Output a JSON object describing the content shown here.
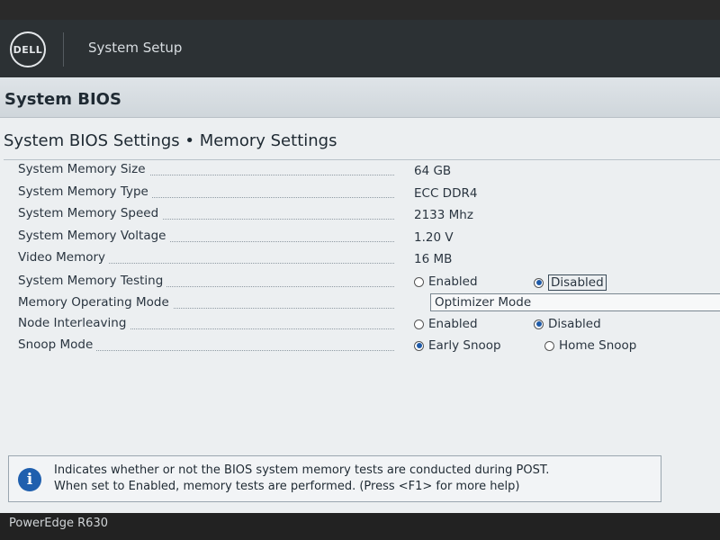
{
  "header": {
    "logo_text": "DELL",
    "app_title": "System Setup"
  },
  "section": {
    "title": "System BIOS"
  },
  "page": {
    "title": "System BIOS Settings • Memory Settings"
  },
  "settings": {
    "memory_size": {
      "label": "System Memory Size",
      "value": "64 GB"
    },
    "memory_type": {
      "label": "System Memory Type",
      "value": "ECC DDR4"
    },
    "memory_speed": {
      "label": "System Memory Speed",
      "value": "2133 Mhz"
    },
    "memory_voltage": {
      "label": "System Memory Voltage",
      "value": "1.20 V"
    },
    "video_memory": {
      "label": "Video Memory",
      "value": "16 MB"
    },
    "memory_testing": {
      "label": "System Memory Testing",
      "options": [
        "Enabled",
        "Disabled"
      ],
      "selected": "Disabled"
    },
    "operating_mode": {
      "label": "Memory Operating Mode",
      "value": "Optimizer Mode"
    },
    "node_interleaving": {
      "label": "Node Interleaving",
      "options": [
        "Enabled",
        "Disabled"
      ],
      "selected": "Disabled"
    },
    "snoop_mode": {
      "label": "Snoop Mode",
      "options": [
        "Early Snoop",
        "Home Snoop"
      ],
      "selected": "Early Snoop"
    }
  },
  "help": {
    "icon": "info-icon",
    "line1": "Indicates whether or not the BIOS system memory tests are conducted during POST.",
    "line2": "When set to Enabled, memory tests are performed. (Press <F1> for more help)"
  },
  "footer": {
    "model": "PowerEdge R630"
  },
  "colors": {
    "topbar": "#2c3134",
    "background": "#eceff1",
    "accent": "#1f5fae"
  }
}
